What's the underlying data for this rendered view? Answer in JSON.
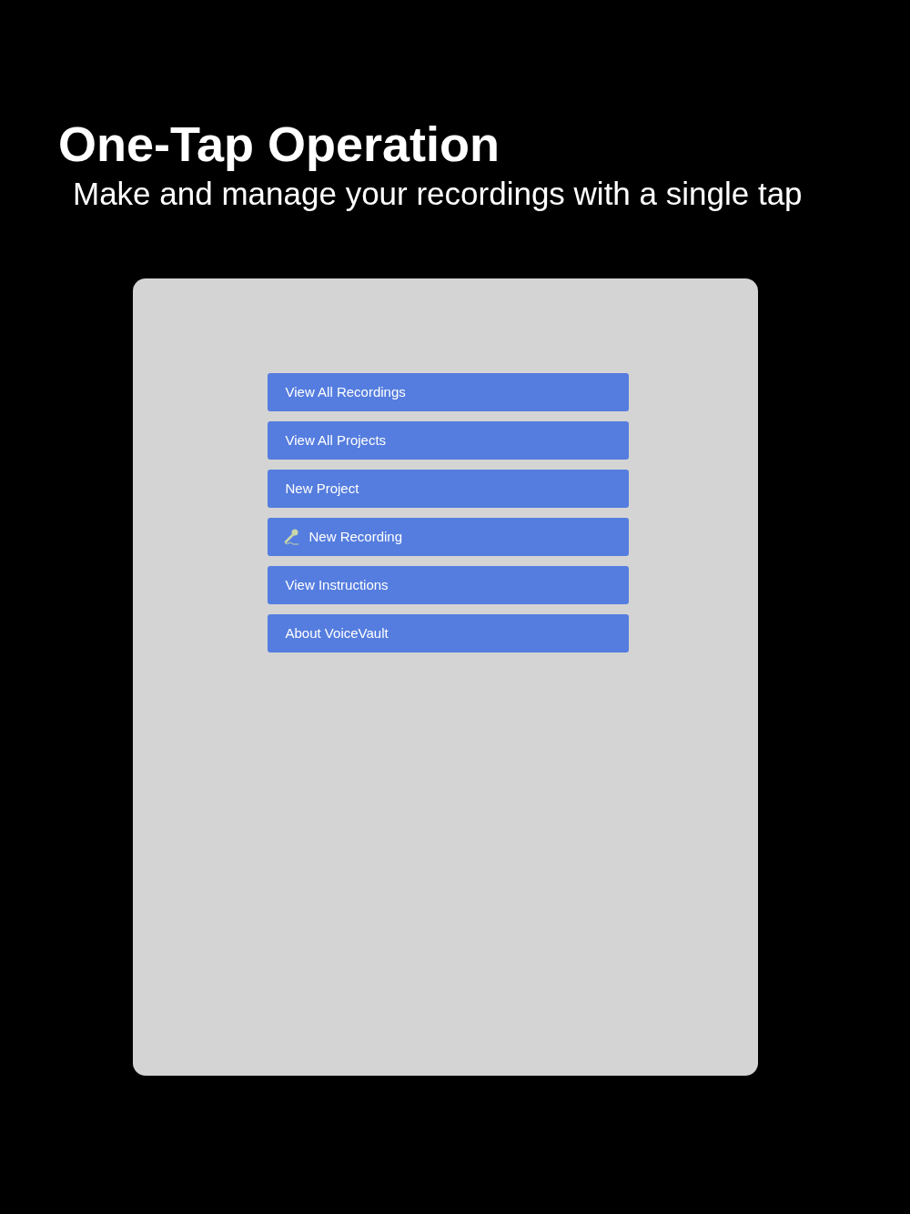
{
  "headline": "One-Tap Operation",
  "subheadline": "Make and manage your recordings with a single tap",
  "menu": [
    {
      "label": "View All Recordings",
      "kind": "plain"
    },
    {
      "label": "View All Projects",
      "kind": "plain"
    },
    {
      "label": "New Project",
      "kind": "plain"
    },
    {
      "label": "New Recording",
      "kind": "mic"
    },
    {
      "label": "View Instructions",
      "kind": "plain"
    },
    {
      "label": "About VoiceVault",
      "kind": "plain"
    }
  ]
}
